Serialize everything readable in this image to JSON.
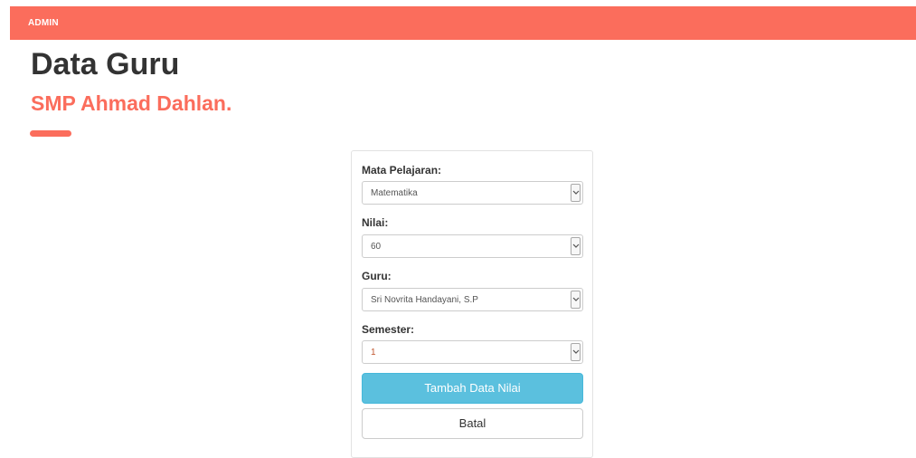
{
  "header": {
    "brand": "ADMIN",
    "accent_color": "#fb6d5c"
  },
  "page": {
    "title": "Data Guru",
    "subtitle": "SMP Ahmad Dahlan."
  },
  "form": {
    "mata_pelajaran": {
      "label": "Mata Pelajaran:",
      "value": "Matematika"
    },
    "nilai": {
      "label": "Nilai:",
      "value": "60"
    },
    "guru": {
      "label": "Guru:",
      "value": "Sri Novrita Handayani, S.P"
    },
    "semester": {
      "label": "Semester:",
      "value": "1"
    },
    "submit_label": "Tambah Data Nilai",
    "cancel_label": "Batal",
    "submit_color": "#5bc0de",
    "dropdown_icon": "chevron-down-icon"
  }
}
